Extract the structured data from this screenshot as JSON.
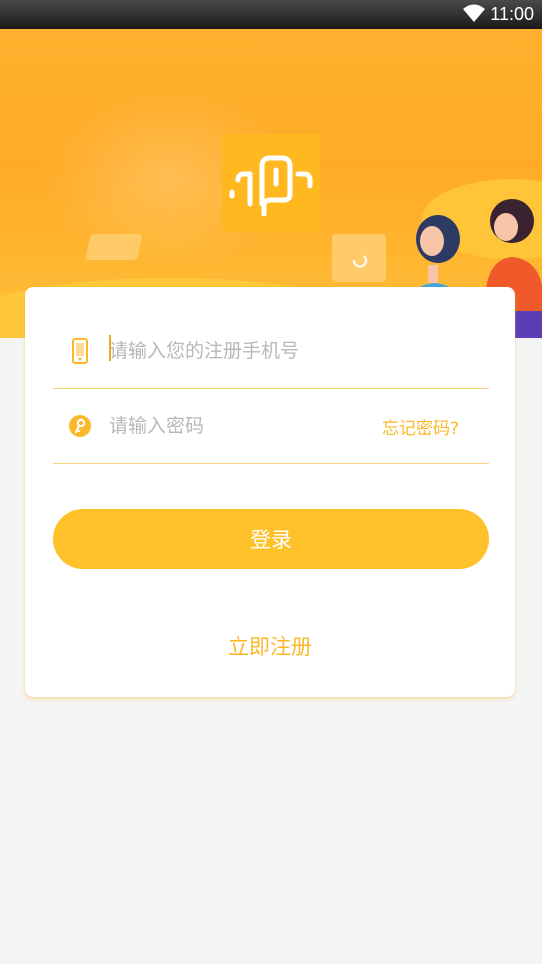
{
  "status_bar": {
    "time": "11:00",
    "wifi_icon": "wifi-icon"
  },
  "banner": {
    "logo_icon": "app-logo-icon",
    "colors": {
      "primary": "#ffb02e",
      "accent": "#ffc12a"
    }
  },
  "login_form": {
    "phone": {
      "icon": "phone-icon",
      "placeholder": "请输入您的注册手机号",
      "value": ""
    },
    "password": {
      "icon": "key-icon",
      "placeholder": "请输入密码",
      "value": ""
    },
    "forgot_label": "忘记密码?",
    "login_label": "登录",
    "register_label": "立即注册"
  }
}
